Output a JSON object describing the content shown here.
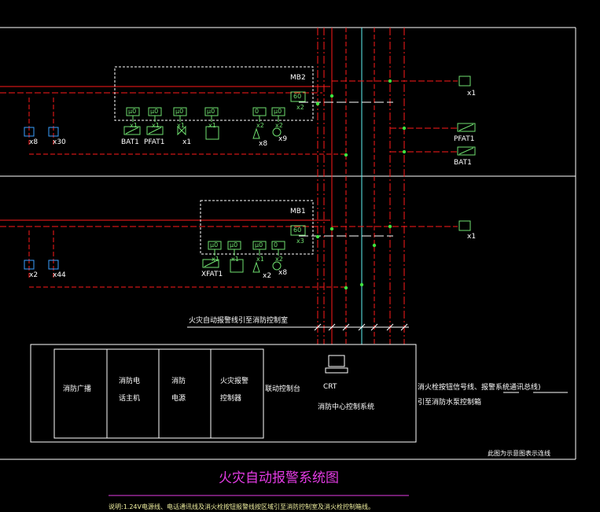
{
  "colors": {
    "background": "#000000",
    "red_line": "#ff1a1a",
    "green_line": "#3fe23f",
    "cyan_line": "#5ff5f5",
    "white_line": "#ffffff",
    "device_green": "#6fe06f",
    "device_blue": "#3aa0ff",
    "title_magenta": "#e23be2"
  },
  "icons": [
    "smoke-detector-icon",
    "heat-detector-icon",
    "manual-call-point-icon",
    "alarm-bell-icon",
    "input-output-module-icon",
    "monitor-icon"
  ],
  "mb2": {
    "label": "MB2",
    "module_labels": [
      "µ0",
      "µ0",
      "µ0",
      "µ0",
      "0",
      "µ0",
      "60"
    ],
    "mults": [
      "x1",
      "x1",
      "x1",
      "x1",
      "x2",
      "x2",
      "x2"
    ],
    "devices": [
      "BAT1",
      "PFAT1",
      "x1",
      "x8",
      "x9"
    ],
    "left_counts": [
      "x8",
      "x30"
    ]
  },
  "mb1": {
    "label": "MB1",
    "module_labels": [
      "µ0",
      "µ0",
      "µ0",
      "0",
      "µ0",
      "60"
    ],
    "mults": [
      "x1",
      "x1",
      "x1",
      "x2",
      "x2",
      "x3"
    ],
    "devices": [
      "XFAT1",
      "x2",
      "x8"
    ],
    "left_counts": [
      "x2",
      "x44"
    ]
  },
  "right_devices": {
    "top_count": "x1",
    "pfat": "PFAT1",
    "bat": "BAT1",
    "mid_count": "x1"
  },
  "bus_note": "火灾自动报警线引至消防控制室",
  "control_room": {
    "cells": [
      [
        "消防广播"
      ],
      [
        "消防电",
        "话主机"
      ],
      [
        "消防",
        "电源"
      ],
      [
        "火灾报警",
        "控制器"
      ],
      [
        "联动控制台"
      ]
    ],
    "crt": "CRT",
    "center_label": "消防中心控制系统"
  },
  "right_notes": {
    "line1": "消火栓按钮信号线、报警系统通讯总线)",
    "line2": "引至消防水泵控制箱"
  },
  "frame_note": "此图为示意图表示连线",
  "title": "火灾自动报警系统图",
  "footnote": "说明:1.24V电源线、电话通讯线及消火栓按钮报警线按区域引至消防控制室及消火栓控制箱线。"
}
